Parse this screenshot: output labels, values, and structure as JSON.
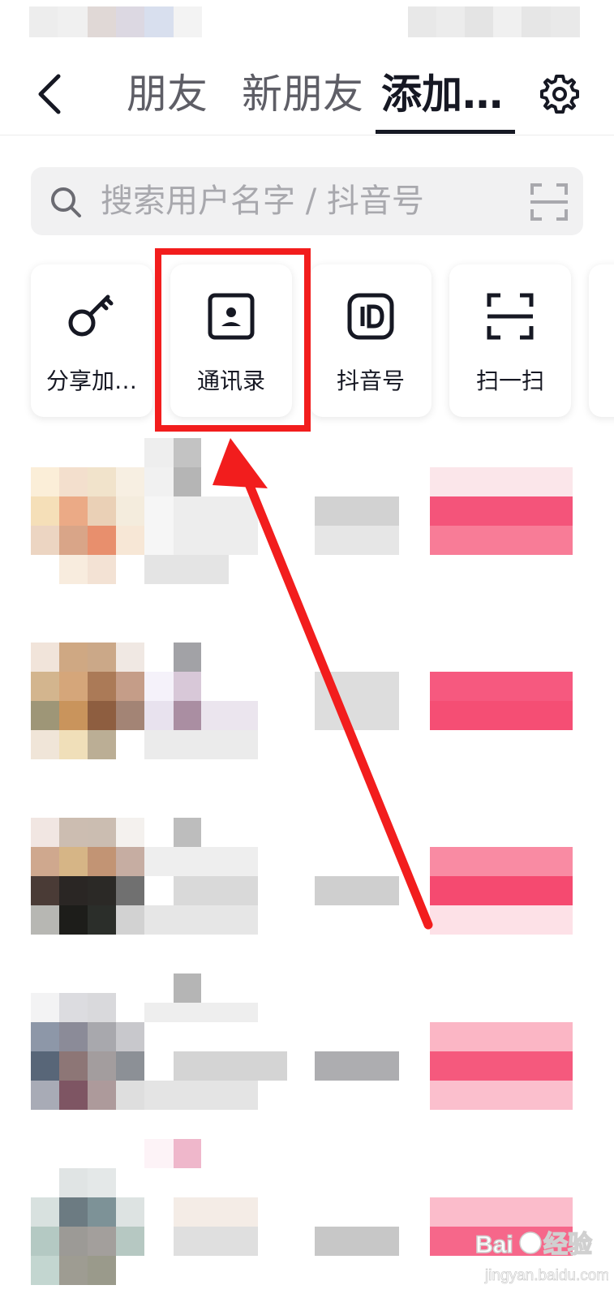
{
  "header": {
    "tabs": [
      {
        "label": "朋友"
      },
      {
        "label": "新朋友"
      },
      {
        "label": "添加…",
        "active": true
      }
    ]
  },
  "search": {
    "placeholder": "搜索用户名字 / 抖音号"
  },
  "quick_actions": [
    {
      "label": "分享加…",
      "icon": "key-icon"
    },
    {
      "label": "通讯录",
      "icon": "contact-book-icon",
      "highlighted": true
    },
    {
      "label": "抖音号",
      "icon": "id-badge-icon"
    },
    {
      "label": "扫一扫",
      "icon": "scan-icon"
    }
  ],
  "watermark": {
    "brand": "Bai du 经验",
    "url": "jingyan.baidu.com"
  },
  "colors": {
    "accent": "#fe2c55",
    "highlight": "#f21d1d",
    "text": "#161823"
  }
}
